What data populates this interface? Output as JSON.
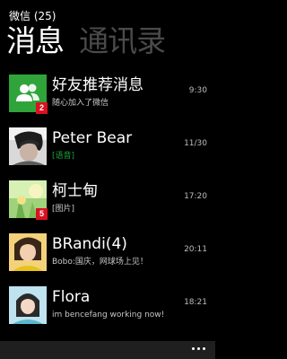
{
  "app": {
    "title": "微信 (25)"
  },
  "pivot": {
    "tabs": [
      {
        "label": "消息"
      },
      {
        "label": "通讯录"
      }
    ]
  },
  "conversations": [
    {
      "name": "好友推荐消息",
      "preview": "随心加入了微信",
      "time": "9:30",
      "badge": "2"
    },
    {
      "name": "Peter Bear",
      "preview": "[语音]",
      "time": "11/30",
      "badge": ""
    },
    {
      "name": "柯士甸",
      "preview": "[图片]",
      "time": "17:20",
      "badge": "5"
    },
    {
      "name": "BRandi(4)",
      "preview": "Bobo:国庆，网球场上见！",
      "time": "20:11",
      "badge": ""
    },
    {
      "name": "Flora",
      "preview": "im bencefang working now!",
      "time": "18:21",
      "badge": ""
    }
  ],
  "appbar": {
    "more_icon": "ellipsis-icon"
  },
  "colors": {
    "accent_green": "#2fa43a",
    "badge_red": "#d8121f",
    "voice_green": "#1aa23a"
  }
}
